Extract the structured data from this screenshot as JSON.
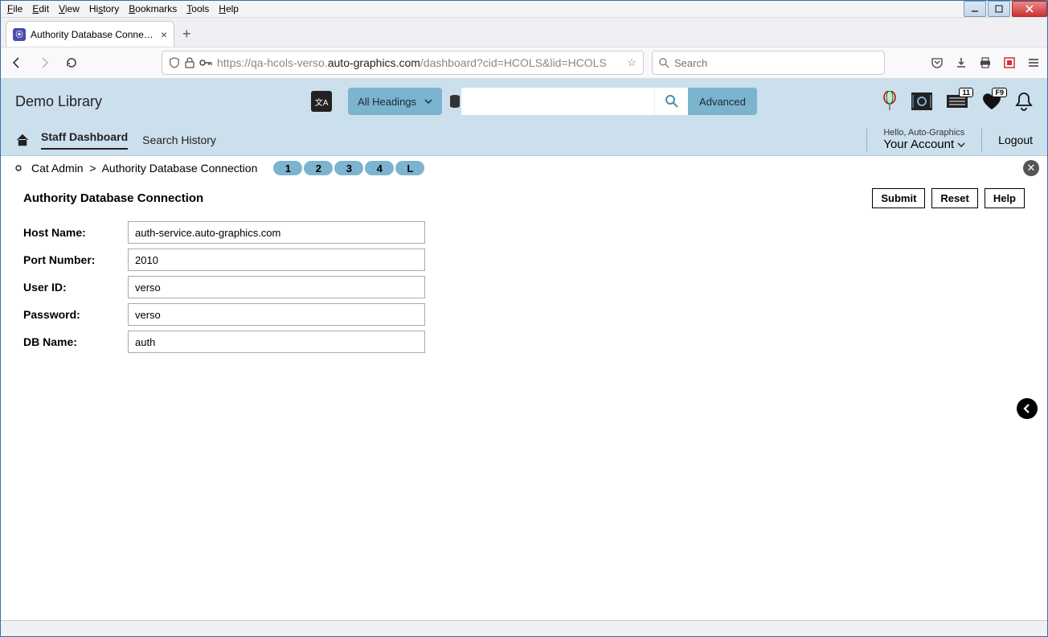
{
  "os_menu": [
    "File",
    "Edit",
    "View",
    "History",
    "Bookmarks",
    "Tools",
    "Help"
  ],
  "tab": {
    "title": "Authority Database Connection"
  },
  "url": {
    "prefix": "https://qa-hcols-verso.",
    "strong": "auto-graphics.com",
    "suffix": "/dashboard?cid=HCOLS&lid=HCOLS"
  },
  "browser_search_placeholder": "Search",
  "library_name": "Demo Library",
  "heading_select": "All Headings",
  "advanced_label": "Advanced",
  "badges": {
    "list": "11",
    "fav": "F9"
  },
  "nav": {
    "staff": "Staff Dashboard",
    "history": "Search History"
  },
  "greeting": "Hello, Auto-Graphics",
  "your_account": "Your Account",
  "logout": "Logout",
  "breadcrumb": {
    "a": "Cat Admin",
    "sep": ">",
    "b": "Authority Database Connection"
  },
  "pills": [
    "1",
    "2",
    "3",
    "4",
    "L"
  ],
  "section_title": "Authority Database Connection",
  "buttons": {
    "submit": "Submit",
    "reset": "Reset",
    "help": "Help"
  },
  "form": {
    "host": {
      "label": "Host Name:",
      "value": "auth-service.auto-graphics.com"
    },
    "port": {
      "label": "Port Number:",
      "value": "2010"
    },
    "user": {
      "label": "User ID:",
      "value": "verso"
    },
    "pass": {
      "label": "Password:",
      "value": "verso"
    },
    "db": {
      "label": "DB Name:",
      "value": "auth"
    }
  }
}
